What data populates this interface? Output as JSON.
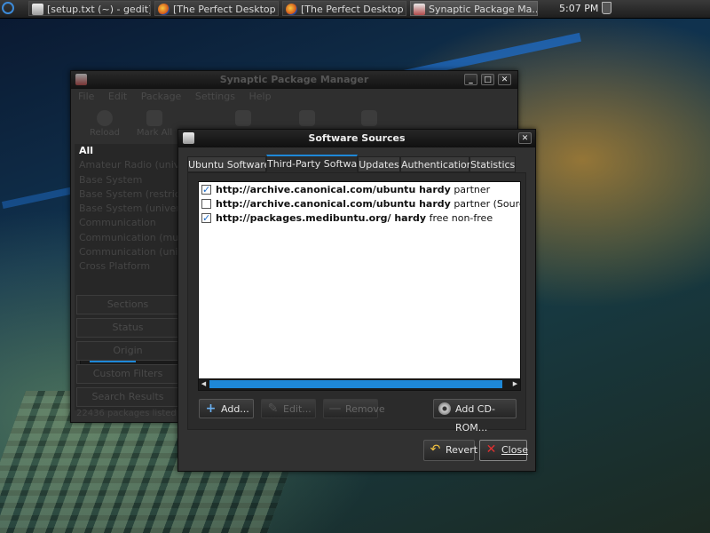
{
  "panel": {
    "tasks": [
      {
        "label": "[setup.txt (~) - gedit]",
        "icon": "gedit-icon"
      },
      {
        "label": "[The Perfect Desktop -",
        "icon": "firefox-icon"
      },
      {
        "label": "[The Perfect Desktop -",
        "icon": "firefox-icon"
      },
      {
        "label": "Synaptic Package Ma...",
        "icon": "synaptic-icon"
      }
    ],
    "clock": "5:07 PM"
  },
  "synaptic": {
    "title": "Synaptic Package Manager",
    "menu": [
      "File",
      "Edit",
      "Package",
      "Settings",
      "Help"
    ],
    "toolbar": [
      "Reload",
      "Mark All",
      "",
      "",
      ""
    ],
    "categories": [
      "All",
      "Amateur Radio (universe)",
      "Base System",
      "Base System (restricted)",
      "Base System (universe)",
      "Communication",
      "Communication (multiverse)",
      "Communication (universe)",
      "Cross Platform"
    ],
    "filters": [
      "Sections",
      "Status",
      "Origin",
      "Custom Filters",
      "Search Results"
    ],
    "status": "22436 packages listed"
  },
  "sources": {
    "title": "Software Sources",
    "tabs": [
      "Ubuntu Software",
      "Third-Party Software",
      "Updates",
      "Authentication",
      "Statistics"
    ],
    "active_tab": "Third-Party Software",
    "entries": [
      {
        "checked": true,
        "bold": "http://archive.canonical.com/ubuntu hardy",
        "rest": " partner"
      },
      {
        "checked": false,
        "bold": "http://archive.canonical.com/ubuntu hardy",
        "rest": " partner (Source Code"
      },
      {
        "checked": true,
        "bold": "http://packages.medibuntu.org/ hardy",
        "rest": " free non-free"
      }
    ],
    "buttons": {
      "add": "Add...",
      "edit": "Edit...",
      "remove": "Remove",
      "add_cdrom": "Add CD-ROM...",
      "revert": "Revert",
      "close": "Close"
    }
  },
  "colors": {
    "accent": "#1e88d8",
    "window_bg": "#313131",
    "titlebar": "#121212"
  }
}
